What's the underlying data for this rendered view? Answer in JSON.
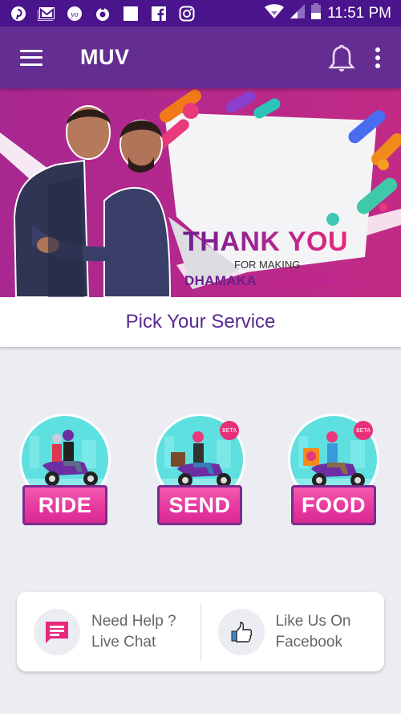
{
  "status_bar": {
    "notification_icons": [
      "pinterest-icon",
      "gmail-icon",
      "yo-app-icon",
      "circle-app-icon",
      "blank-app-icon",
      "facebook-icon",
      "instagram-icon"
    ],
    "wifi_icon": "wifi-icon",
    "signal_icon": "signal-icon",
    "battery_icon": "battery-icon",
    "time": "11:51 PM"
  },
  "app_bar": {
    "title": "MUV",
    "menu_icon": "hamburger-menu-icon",
    "notification_icon": "bell-icon",
    "overflow_icon": "more-vertical-icon"
  },
  "banner": {
    "headline": "THANK YOU",
    "subline": "FOR MAKING",
    "tagline_part1": "DHAMAKA",
    "tagline_part2": "SUCCESSFUL"
  },
  "section": {
    "title": "Pick Your Service"
  },
  "services": [
    {
      "label": "RIDE",
      "badge": null
    },
    {
      "label": "SEND",
      "badge": "BETA"
    },
    {
      "label": "FOOD",
      "badge": "BETA"
    }
  ],
  "help": {
    "chat": {
      "line1": "Need Help ?",
      "line2": "Live Chat"
    },
    "facebook": {
      "line1": "Like Us On",
      "line2": "Facebook"
    }
  },
  "colors": {
    "status_bar": "#4a148c",
    "app_bar": "#632d92",
    "accent_pink": "#e8399f",
    "title_purple": "#5a2a8e",
    "background": "#ebedf2"
  }
}
